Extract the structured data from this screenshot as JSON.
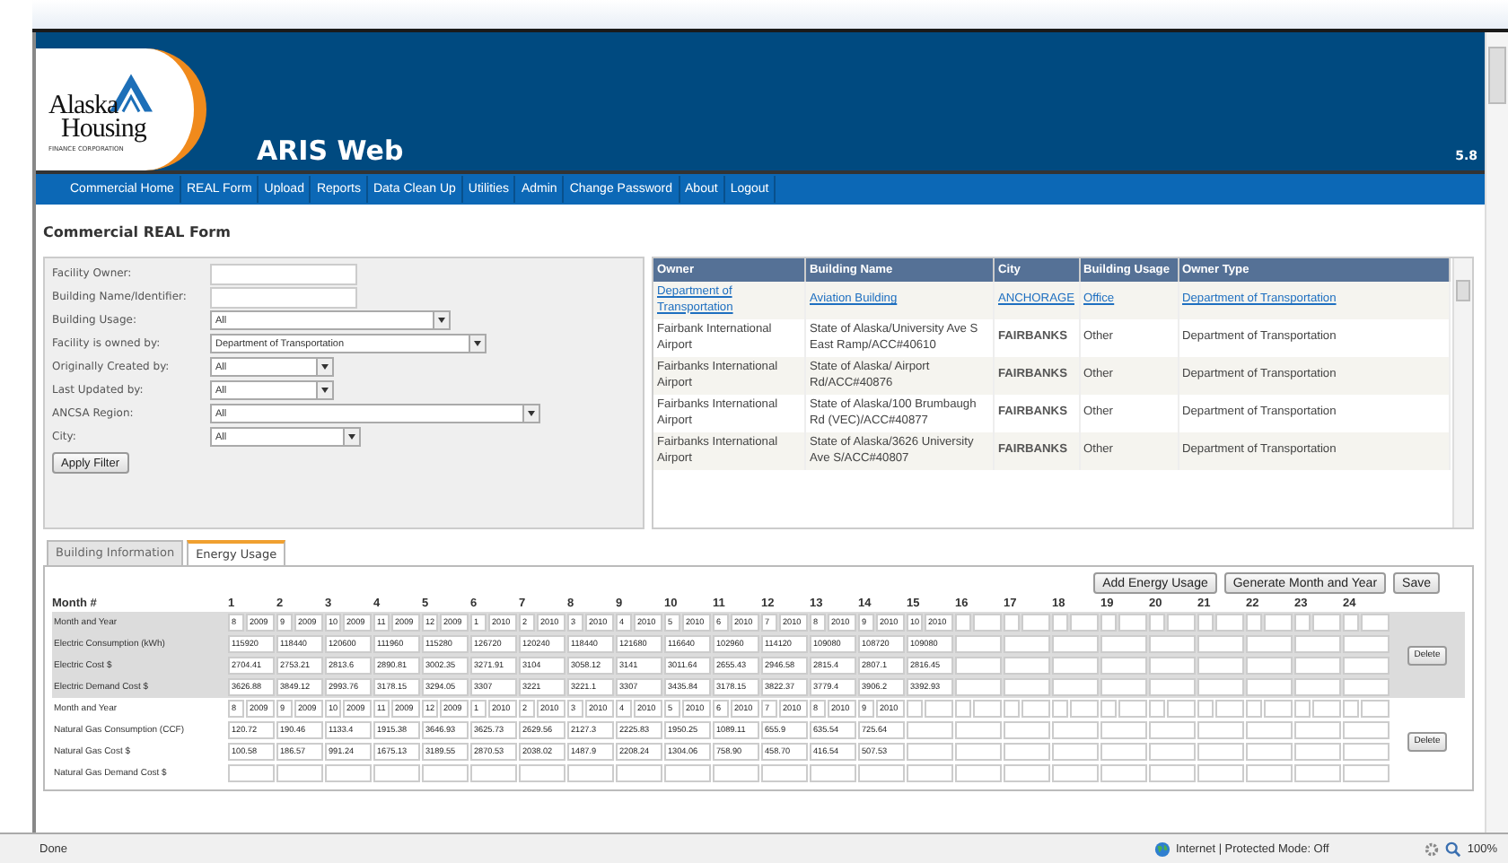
{
  "logo": {
    "line_1": "Alaska",
    "line_2": "Housing",
    "line_3": "FINANCE CORPORATION"
  },
  "app": {
    "title": "ARIS Web",
    "version": "5.8"
  },
  "nav": [
    "Commercial Home",
    "REAL Form",
    "Upload",
    "Reports",
    "Data Clean Up",
    "Utilities",
    "Admin",
    "Change Password",
    "About",
    "Logout"
  ],
  "page_title": "Commercial REAL Form",
  "filters": [
    {
      "label": "Facility Owner:",
      "kind": "text"
    },
    {
      "label": "Building Name/Identifier:",
      "kind": "text"
    },
    {
      "label": "Building Usage:",
      "kind": "select",
      "value": "All"
    },
    {
      "label": "Facility is owned by:",
      "kind": "select",
      "value": "Department of Transportation"
    },
    {
      "label": "Originally Created by:",
      "kind": "select",
      "value": "All"
    },
    {
      "label": "Last Updated by:",
      "kind": "select",
      "value": "All"
    },
    {
      "label": "ANCSA Region:",
      "kind": "select",
      "value": "All"
    },
    {
      "label": "City:",
      "kind": "select",
      "value": "All"
    }
  ],
  "apply_button": "Apply Filter",
  "table": {
    "columns": [
      "Owner",
      "Building Name",
      "City",
      "Building Usage",
      "Owner Type"
    ],
    "rows": [
      {
        "link": true,
        "cells": [
          "Department of Transportation",
          "Aviation Building",
          "ANCHORAGE",
          "Office",
          "Department of Transportation"
        ]
      },
      {
        "link": false,
        "cells": [
          "Fairbank International Airport",
          "State of Alaska/University Ave S East Ramp/ACC#40610",
          "FAIRBANKS",
          "Other",
          "Department of Transportation"
        ]
      },
      {
        "link": false,
        "cells": [
          "Fairbanks International Airport",
          "State of Alaska/ Airport Rd/ACC#40876",
          "FAIRBANKS",
          "Other",
          "Department of Transportation"
        ]
      },
      {
        "link": false,
        "cells": [
          "Fairbanks International Airport",
          "State of Alaska/100 Brumbaugh Rd (VEC)/ACC#40877",
          "FAIRBANKS",
          "Other",
          "Department of Transportation"
        ]
      },
      {
        "link": false,
        "cells": [
          "Fairbanks International Airport",
          "State of Alaska/3626 University Ave S/ACC#40807",
          "FAIRBANKS",
          "Other",
          "Department of Transportation"
        ]
      }
    ]
  },
  "tabs": [
    {
      "label": "Building Information",
      "selected": false
    },
    {
      "label": "Energy Usage",
      "selected": true
    }
  ],
  "energy": {
    "buttons": [
      "Add Energy Usage",
      "Generate Month and Year",
      "Save"
    ],
    "month_heading": "Month #",
    "months": [
      "1",
      "2",
      "3",
      "4",
      "5",
      "6",
      "7",
      "8",
      "9",
      "10",
      "11",
      "12",
      "13",
      "14",
      "15",
      "16",
      "17",
      "18",
      "19",
      "20",
      "21",
      "22",
      "23",
      "24"
    ],
    "groups": [
      {
        "shaded": true,
        "delete": "Delete",
        "rows": [
          {
            "label": "Month and Year",
            "kind": "month_year",
            "values": [
              [
                "8",
                "2009"
              ],
              [
                "9",
                "2009"
              ],
              [
                "10",
                "2009"
              ],
              [
                "11",
                "2009"
              ],
              [
                "12",
                "2009"
              ],
              [
                "1",
                "2010"
              ],
              [
                "2",
                "2010"
              ],
              [
                "3",
                "2010"
              ],
              [
                "4",
                "2010"
              ],
              [
                "5",
                "2010"
              ],
              [
                "6",
                "2010"
              ],
              [
                "7",
                "2010"
              ],
              [
                "8",
                "2010"
              ],
              [
                "9",
                "2010"
              ],
              [
                "10",
                "2010"
              ]
            ]
          },
          {
            "label": "Electric Consumption (kWh)",
            "kind": "number",
            "values": [
              "115920",
              "118440",
              "120600",
              "111960",
              "115280",
              "126720",
              "120240",
              "118440",
              "121680",
              "116640",
              "102960",
              "114120",
              "109080",
              "108720",
              "109080"
            ]
          },
          {
            "label": "Electric Cost $",
            "kind": "number",
            "values": [
              "2704.41",
              "2753.21",
              "2813.6",
              "2890.81",
              "3002.35",
              "3271.91",
              "3104",
              "3058.12",
              "3141",
              "3011.64",
              "2655.43",
              "2946.58",
              "2815.4",
              "2807.1",
              "2816.45"
            ]
          },
          {
            "label": "Electric Demand Cost $",
            "kind": "number",
            "values": [
              "3626.88",
              "3849.12",
              "2993.76",
              "3178.15",
              "3294.05",
              "3307",
              "3221",
              "3221.1",
              "3307",
              "3435.84",
              "3178.15",
              "3822.37",
              "3779.4",
              "3906.2",
              "3392.93"
            ]
          }
        ]
      },
      {
        "shaded": false,
        "delete": "Delete",
        "rows": [
          {
            "label": "Month and Year",
            "kind": "month_year",
            "values": [
              [
                "8",
                "2009"
              ],
              [
                "9",
                "2009"
              ],
              [
                "10",
                "2009"
              ],
              [
                "11",
                "2009"
              ],
              [
                "12",
                "2009"
              ],
              [
                "1",
                "2010"
              ],
              [
                "2",
                "2010"
              ],
              [
                "3",
                "2010"
              ],
              [
                "4",
                "2010"
              ],
              [
                "5",
                "2010"
              ],
              [
                "6",
                "2010"
              ],
              [
                "7",
                "2010"
              ],
              [
                "8",
                "2010"
              ],
              [
                "9",
                "2010"
              ]
            ]
          },
          {
            "label": "Natural Gas Consumption (CCF)",
            "kind": "number",
            "values": [
              "120.72",
              "190.46",
              "1133.4",
              "1915.38",
              "3646.93",
              "3625.73",
              "2629.56",
              "2127.3",
              "2225.83",
              "1950.25",
              "1089.11",
              "655.9",
              "635.54",
              "725.64"
            ]
          },
          {
            "label": "Natural Gas Cost $",
            "kind": "number",
            "values": [
              "100.58",
              "186.57",
              "991.24",
              "1675.13",
              "3189.55",
              "2870.53",
              "2038.02",
              "1487.9",
              "2208.24",
              "1304.06",
              "758.90",
              "458.70",
              "416.54",
              "507.53"
            ]
          },
          {
            "label": "Natural Gas Demand Cost $",
            "kind": "number",
            "values": []
          }
        ]
      }
    ]
  },
  "status_bar": {
    "text": "Done",
    "zone": "Internet | Protected Mode: Off",
    "zoom": "100%"
  }
}
